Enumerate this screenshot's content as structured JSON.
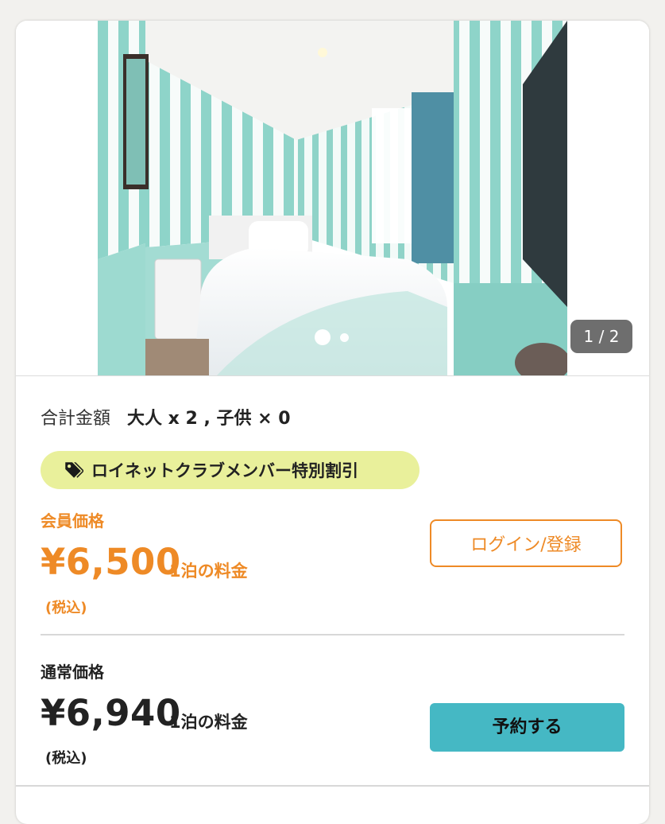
{
  "gallery": {
    "counter": "1 / 2",
    "image_alt": "Hotel room with striped walls and bed",
    "current_slide": 1,
    "total_slides": 2
  },
  "summary": {
    "total_label": "合計金額",
    "guests": "大人 x 2 , 子供 × 0"
  },
  "badge": {
    "label": "ロイネットクラブメンバー特別割引",
    "icon": "tag-icon",
    "color": "#e9f09b"
  },
  "member": {
    "label": "会員価格",
    "price": "¥6,500",
    "unit": "1泊の料金",
    "tax": "(税込)",
    "button": "ログイン/登録",
    "color": "#ee8a26"
  },
  "regular": {
    "label": "通常価格",
    "price": "¥6,940",
    "unit": "1泊の料金",
    "tax": "(税込)",
    "button": "予約する",
    "button_color": "#45b8c4"
  }
}
